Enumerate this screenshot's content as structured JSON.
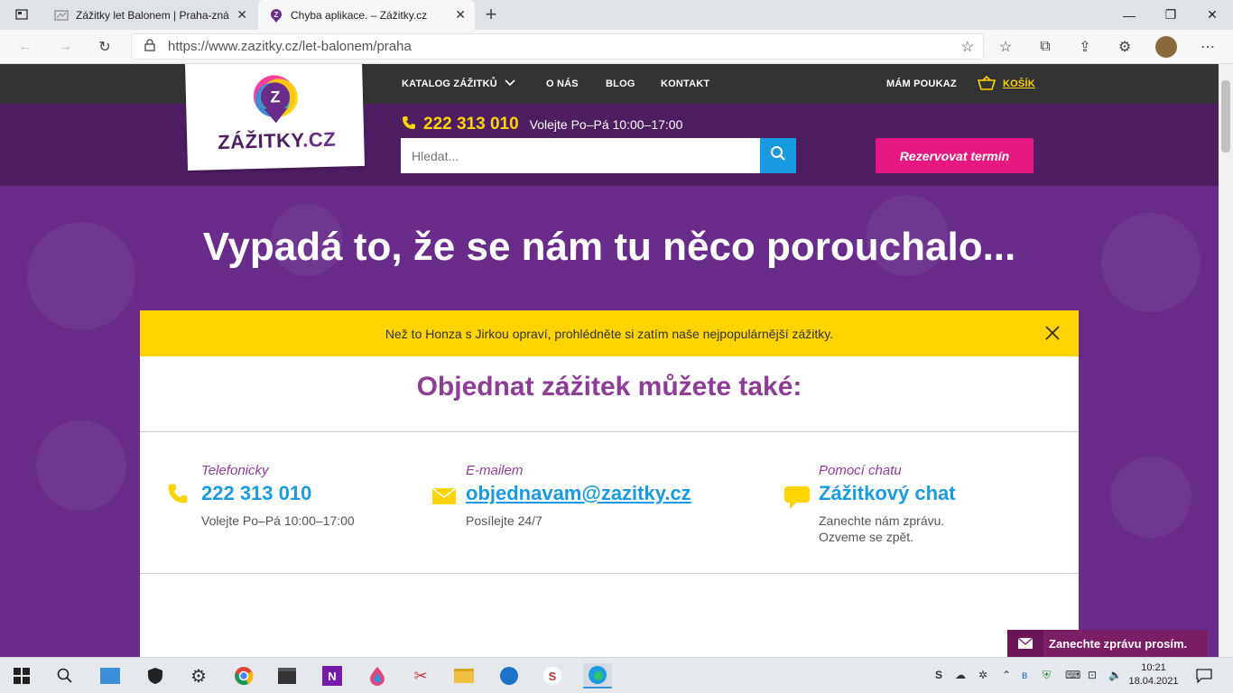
{
  "browser": {
    "tabs": [
      {
        "title": "Zážitky let Balonem | Praha-znáte"
      },
      {
        "title": "Chyba aplikace. – Zážitky.cz"
      }
    ],
    "url": "https://www.zazitky.cz/let-balonem/praha"
  },
  "site": {
    "logo_text": "ZÁŽITKY",
    "logo_tld": ".CZ",
    "logo_letter": "Z",
    "nav": {
      "catalog": "KATALOG ZÁŽITKŮ",
      "about": "O NÁS",
      "blog": "BLOG",
      "contact": "KONTAKT",
      "voucher": "MÁM POUKAZ",
      "cart": "KOŠÍK"
    },
    "phone": "222 313 010",
    "phone_hours": "Volejte Po–Pá 10:00–17:00",
    "search_placeholder": "Hledat...",
    "reserve_button": "Rezervovat termín",
    "headline": "Vypadá to, že se nám tu něco porouchalo...",
    "notice": "Než to Honza s Jirkou opraví, prohlédněte si zatím naše nejpopulárnější zážitky.",
    "order_title": "Objednat zážitek můžete také:",
    "contacts": [
      {
        "label": "Telefonicky",
        "value": "222 313 010",
        "desc": "Volejte Po–Pá 10:00–17:00",
        "icon": "phone-icon"
      },
      {
        "label": "E-mailem",
        "value": "objednavam@zazitky.cz",
        "desc": "Posílejte 24/7",
        "icon": "mail-icon"
      },
      {
        "label": "Pomocí chatu",
        "value": "Zážitkový chat",
        "desc1": "Zanechte nám zprávu.",
        "desc2": "Ozveme se zpět.",
        "icon": "chat-icon"
      }
    ],
    "chat_widget": "Zanechte zprávu prosím."
  },
  "taskbar": {
    "time": "10:21",
    "date": "18.04.2021"
  },
  "colors": {
    "purple": "#6a2c8b",
    "dark_purple": "#4e1e63",
    "yellow": "#ffd400",
    "pink": "#e6177e",
    "blue": "#1a9ae0",
    "title_purple": "#8e3d96"
  }
}
